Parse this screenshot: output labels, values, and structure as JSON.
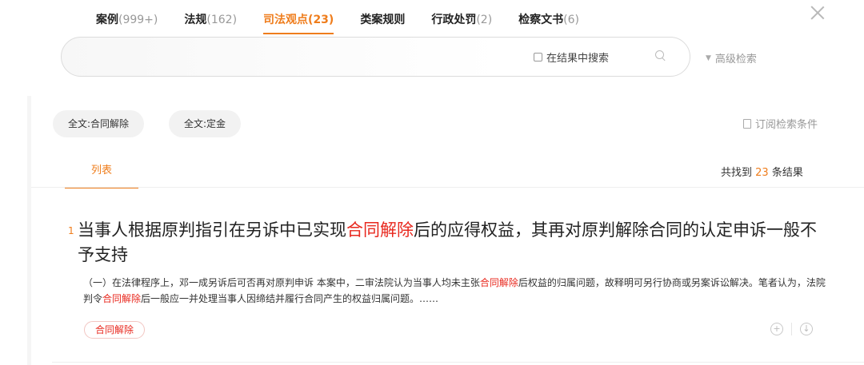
{
  "tabs": [
    {
      "name": "案例",
      "count": "(999+)",
      "active": false
    },
    {
      "name": "法规",
      "count": "(162)",
      "active": false
    },
    {
      "name": "司法观点",
      "count": "(23)",
      "active": true
    },
    {
      "name": "类案规则",
      "count": "",
      "active": false
    },
    {
      "name": "行政处罚",
      "count": "(2)",
      "active": false
    },
    {
      "name": "检察文书",
      "count": "(6)",
      "active": false
    }
  ],
  "search": {
    "placeholder": "",
    "in_results_label": "在结果中搜索",
    "advanced_label": "高级检索"
  },
  "filters": {
    "chips": [
      "全文:合同解除",
      "全文:定金"
    ],
    "subscribe_label": "订阅检索条件"
  },
  "list_header": {
    "tab_label": "列表",
    "count_prefix": "共找到",
    "count": "23",
    "count_suffix": "条结果"
  },
  "results": [
    {
      "index": "1",
      "title_pre": "当事人根据原判指引在另诉中已实现",
      "title_hl": "合同解除",
      "title_post": "后的应得权益，其再对原判解除合同的认定申诉一般不予支持",
      "snippet_1": "（一）在法律程序上，邓一成另诉后可否再对原判申诉 本案中，二审法院认为当事人均未主张",
      "snippet_hl_1": "合同解除",
      "snippet_2": "后权益的归属问题，故释明可另行协商或另案诉讼解决。笔者认为，法院判令",
      "snippet_hl_2": "合同解除",
      "snippet_3": "后一般应一并处理当事人因缔结并履行合同产生的权益归属问题。……",
      "tag": "合同解除"
    }
  ],
  "colors": {
    "accent": "#ef7d1c",
    "highlight": "#e8281e"
  },
  "icons": {
    "close": "close-icon",
    "search": "search-icon",
    "advanced": "triangle-down-icon",
    "subscribe": "flag-icon",
    "add": "plus-circle-icon",
    "download": "download-circle-icon"
  }
}
